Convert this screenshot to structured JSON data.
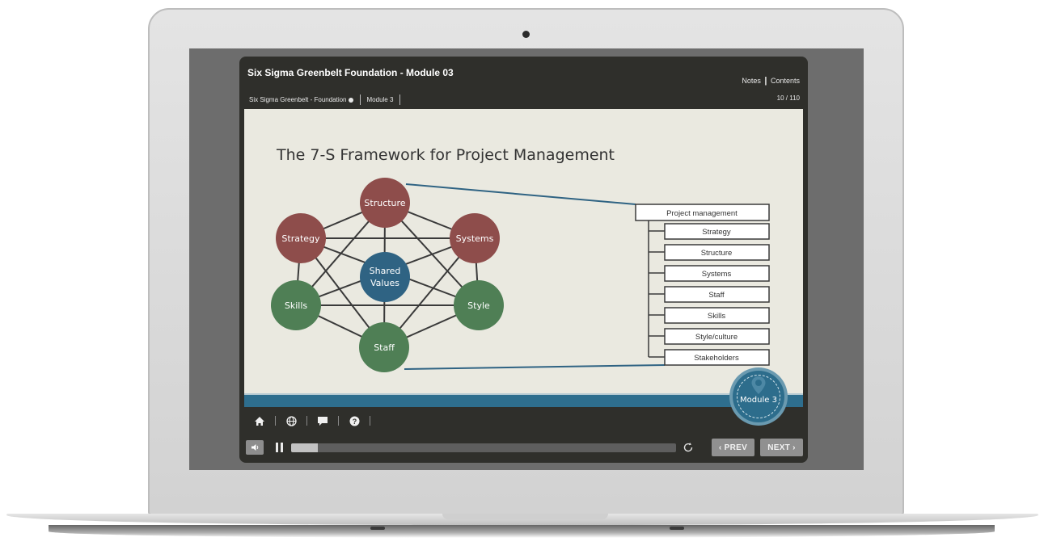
{
  "player": {
    "course_title": "Six Sigma Greenbelt Foundation - Module 03",
    "links": {
      "notes": "Notes",
      "separator": "|",
      "contents": "Contents"
    },
    "breadcrumbs": [
      "Six Sigma Greenbelt - Foundation",
      "Module 3"
    ],
    "page_count": "10 / 110"
  },
  "slide": {
    "title": "The 7-S Framework for Project Management",
    "diagram": {
      "center": {
        "label_line1": "Shared",
        "label_line2": "Values"
      },
      "nodes": {
        "structure": "Structure",
        "strategy": "Strategy",
        "systems": "Systems",
        "skills": "Skills",
        "style": "Style",
        "staff": "Staff"
      },
      "tree_root": "Project management",
      "tree_items": [
        "Strategy",
        "Structure",
        "Systems",
        "Staff",
        "Skills",
        "Style/culture",
        "Stakeholders"
      ]
    }
  },
  "toolbar": {
    "icons": [
      "home-icon",
      "globe-icon",
      "chat-icon",
      "help-icon"
    ]
  },
  "controls": {
    "progress": 0.07,
    "prev_label": "‹ PREV",
    "next_label": "NEXT ›"
  },
  "badge": {
    "label": "Module 3"
  },
  "colors": {
    "red_node": "#8e4d4b",
    "green_node": "#4f7f55",
    "blue_node": "#2f6383",
    "ribbon": "#2e6e8e",
    "player_bg": "#2f2f2b"
  }
}
